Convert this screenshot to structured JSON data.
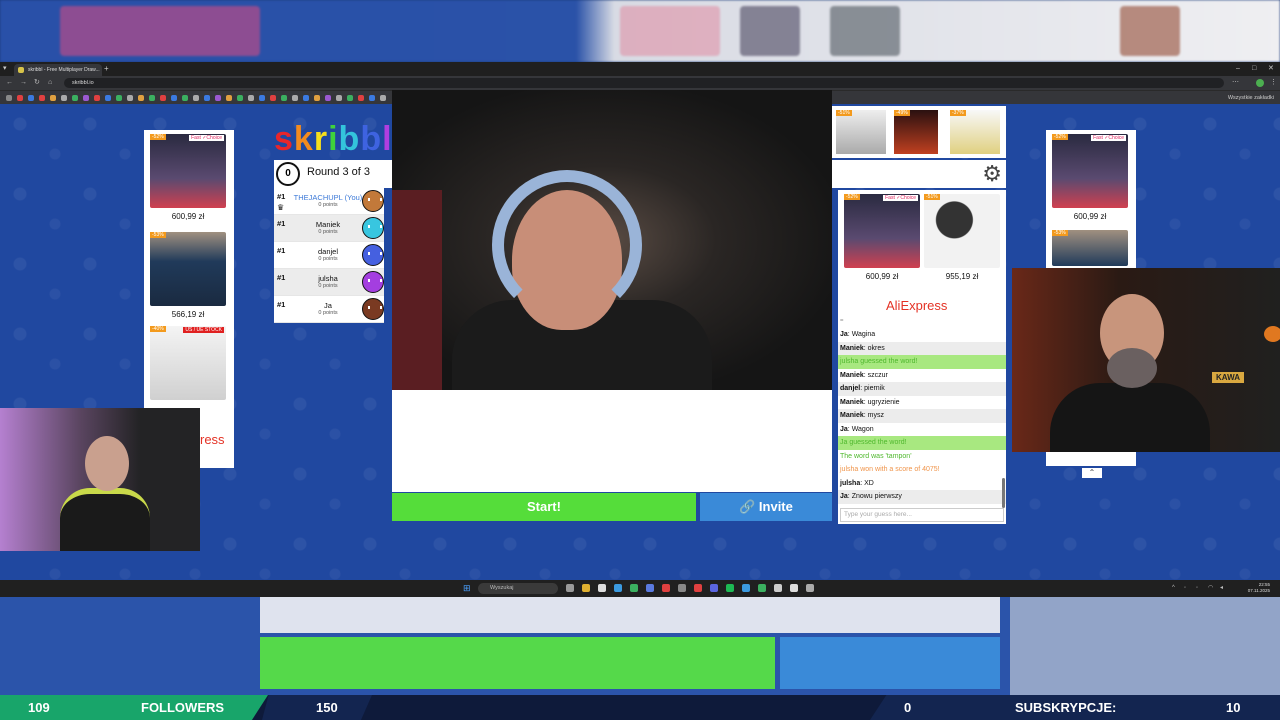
{
  "browser": {
    "tab_title": "skribbl - Free Multiplayer Draw...",
    "new_tab": "+",
    "url": "skribbl.io",
    "bookmarks_right": "Wszystkie zakładki",
    "window_controls": [
      "–",
      "□",
      "✕"
    ]
  },
  "game": {
    "logo": "skribbl",
    "logo_colors": [
      "#e8262b",
      "#f28b1f",
      "#f6df1c",
      "#3fd23b",
      "#33c4dc",
      "#3e63e0",
      "#b03ee0",
      "#e0479a"
    ],
    "round_timer": "0",
    "round_label": "Round 3 of 3",
    "players": [
      {
        "rank": "#1",
        "name": "THEJACHUPL (You)",
        "points": "0 points",
        "is_me": true,
        "avatar_color": "#c2793a",
        "has_crown": true
      },
      {
        "rank": "#1",
        "name": "Maniek",
        "points": "0 points",
        "is_me": false,
        "avatar_color": "#38c6e0",
        "has_crown": false
      },
      {
        "rank": "#1",
        "name": "danjel",
        "points": "0 points",
        "is_me": false,
        "avatar_color": "#4560e0",
        "has_crown": false
      },
      {
        "rank": "#1",
        "name": "julsha",
        "points": "0 points",
        "is_me": false,
        "avatar_color": "#a43ee0",
        "has_crown": false
      },
      {
        "rank": "#1",
        "name": "Ja",
        "points": "0 points",
        "is_me": false,
        "avatar_color": "#7a3a22",
        "has_crown": false
      }
    ],
    "start_button": "Start!",
    "invite_button": "🔗 Invite"
  },
  "ads": {
    "left": [
      {
        "badge": "-52%",
        "tag": "Fast ✓Choice",
        "price": "600,99 zł",
        "color": "#3a3450"
      },
      {
        "badge": "-53%",
        "tag": "",
        "price": "566,19 zł",
        "color": "#2a4a6a"
      },
      {
        "badge": "-40%",
        "tag": "US / UE STOCK",
        "price": "",
        "color": "#d8d8d8"
      }
    ],
    "left_brand_partial": "ress",
    "top_right_badges": [
      "-51%",
      "-49%",
      "-37%"
    ],
    "middle": [
      {
        "badge": "-52%",
        "tag": "Fast ✓Choice",
        "price": "600,99 zł",
        "color": "#3a3450"
      },
      {
        "badge": "-51%",
        "tag": "",
        "price": "955,19 zł",
        "color": "#e8e8e8"
      }
    ],
    "brand": "AliExpress",
    "right": [
      {
        "badge": "-52%",
        "tag": "Fast ✓Choice",
        "price": "600,99 zł",
        "color": "#3a3450"
      },
      {
        "badge": "-53%",
        "tag": "",
        "price": "",
        "color": "#2a4a6a"
      }
    ]
  },
  "chat": {
    "messages": [
      {
        "author": "Ja",
        "text": "Wagina",
        "style": "normal"
      },
      {
        "author": "Maniek",
        "text": "okres",
        "style": "alt"
      },
      {
        "author": "",
        "text": "julsha guessed the word!",
        "style": "green"
      },
      {
        "author": "Maniek",
        "text": "szczur",
        "style": "normal"
      },
      {
        "author": "danjel",
        "text": "piernik",
        "style": "alt"
      },
      {
        "author": "Maniek",
        "text": "ugryzienie",
        "style": "normal"
      },
      {
        "author": "Maniek",
        "text": "mysz",
        "style": "alt"
      },
      {
        "author": "Ja",
        "text": "Wagon",
        "style": "normal"
      },
      {
        "author": "",
        "text": "Ja guessed the word!",
        "style": "green"
      },
      {
        "author": "",
        "text": "The word was 'tampon'",
        "style": "greentext"
      },
      {
        "author": "",
        "text": "julsha won with a score of 4075!",
        "style": "orange"
      },
      {
        "author": "julsha",
        "text": "XD",
        "style": "normal"
      },
      {
        "author": "Ja",
        "text": "Znowu pierwszy",
        "style": "alt"
      }
    ],
    "input_placeholder": "Type your guess here..."
  },
  "webcam_right": {
    "sign": "KAWA"
  },
  "taskbar": {
    "search": "Wyszukaj",
    "time": "22:55",
    "date": "07.11.2025"
  },
  "overlay": {
    "followers_current": "109",
    "followers_label": "FOLLOWERS",
    "followers_goal": "150",
    "subs_current": "0",
    "subs_label": "SUBSKRYPCJE:",
    "subs_goal": "10"
  }
}
